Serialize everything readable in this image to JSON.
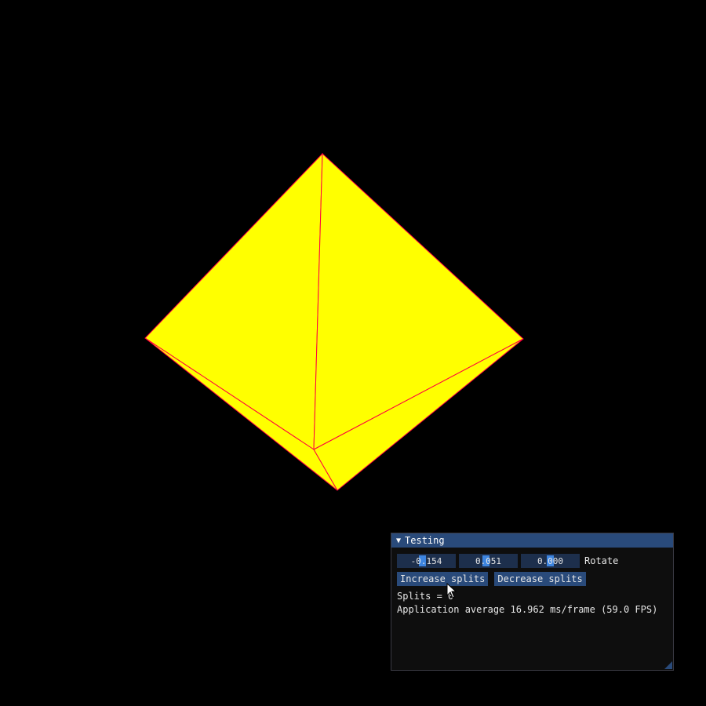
{
  "window": {
    "title": "Testing",
    "collapse_icon": "triangle-down-icon"
  },
  "sliders": [
    {
      "value": "-0.154",
      "fraction": 0.42
    },
    {
      "value": "0.051",
      "fraction": 0.45
    },
    {
      "value": "0.000",
      "fraction": 0.5
    }
  ],
  "rotate_label": "Rotate",
  "buttons": {
    "increase": "Increase splits",
    "decrease": "Decrease splits"
  },
  "splits_text": "Splits = 0",
  "perf_text": "Application average 16.962 ms/frame (59.0 FPS)",
  "colors": {
    "background": "#000000",
    "shape_fill": "#ffff00",
    "shape_edge": "#ff0040",
    "accent": "#294a7a"
  }
}
